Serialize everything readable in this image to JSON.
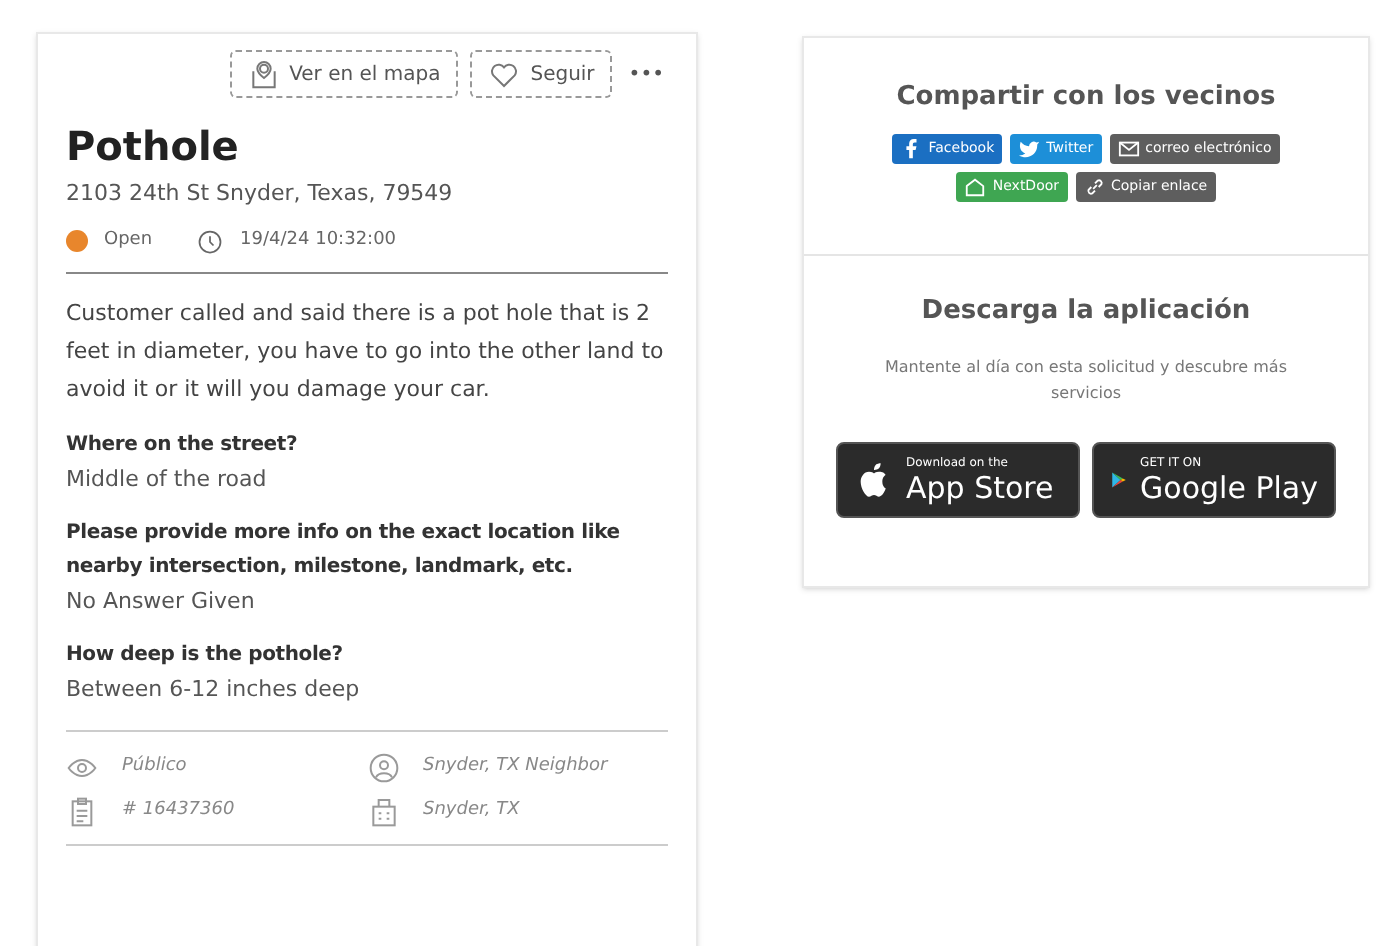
{
  "actions": {
    "map_button": "Ver en el mapa",
    "follow_button": "Seguir",
    "more": "•••"
  },
  "request": {
    "title": "Pothole",
    "address": "2103 24th St Snyder, Texas, 79549",
    "status": {
      "label": "Open",
      "color": "#e8862c"
    },
    "timestamp": "19/4/24 10:32:00",
    "description": "Customer called and said there is a pot hole that is 2 feet in diameter, you have to go into the other land to avoid it or it will you damage your car.",
    "questions": [
      {
        "question": "Where on the street?",
        "answer": "Middle of the road"
      },
      {
        "question": "Please provide more info on the exact location like nearby intersection, milestone, landmark, etc.",
        "answer": "No Answer Given"
      },
      {
        "question": "How deep is the pothole?",
        "answer": "Between 6-12 inches deep"
      }
    ],
    "meta": [
      {
        "kind": "visibility",
        "text": "Público"
      },
      {
        "kind": "reporter",
        "text": "Snyder, TX Neighbor"
      },
      {
        "kind": "id",
        "text": "# 16437360"
      },
      {
        "kind": "city",
        "text": "Snyder, TX"
      }
    ]
  },
  "share": {
    "title": "Compartir con los vecinos",
    "buttons": [
      {
        "kind": "facebook",
        "label": "Facebook",
        "color": "#1b6fc2"
      },
      {
        "kind": "twitter",
        "label": "Twitter",
        "color": "#1d8fd8"
      },
      {
        "kind": "email",
        "label": "correo electrónico",
        "color": "#5e5e5e"
      },
      {
        "kind": "nextdoor",
        "label": "NextDoor",
        "color": "#3fa652"
      },
      {
        "kind": "link",
        "label": "Copiar enlace",
        "color": "#5e5e5e"
      }
    ]
  },
  "app": {
    "title": "Descarga la aplicación",
    "text": "Mantente al día con esta solicitud y descubre más servicios",
    "stores": [
      {
        "kind": "apple",
        "small": "Download on the",
        "big": "App Store"
      },
      {
        "kind": "google",
        "small": "GET IT ON",
        "big": "Google Play"
      }
    ]
  }
}
